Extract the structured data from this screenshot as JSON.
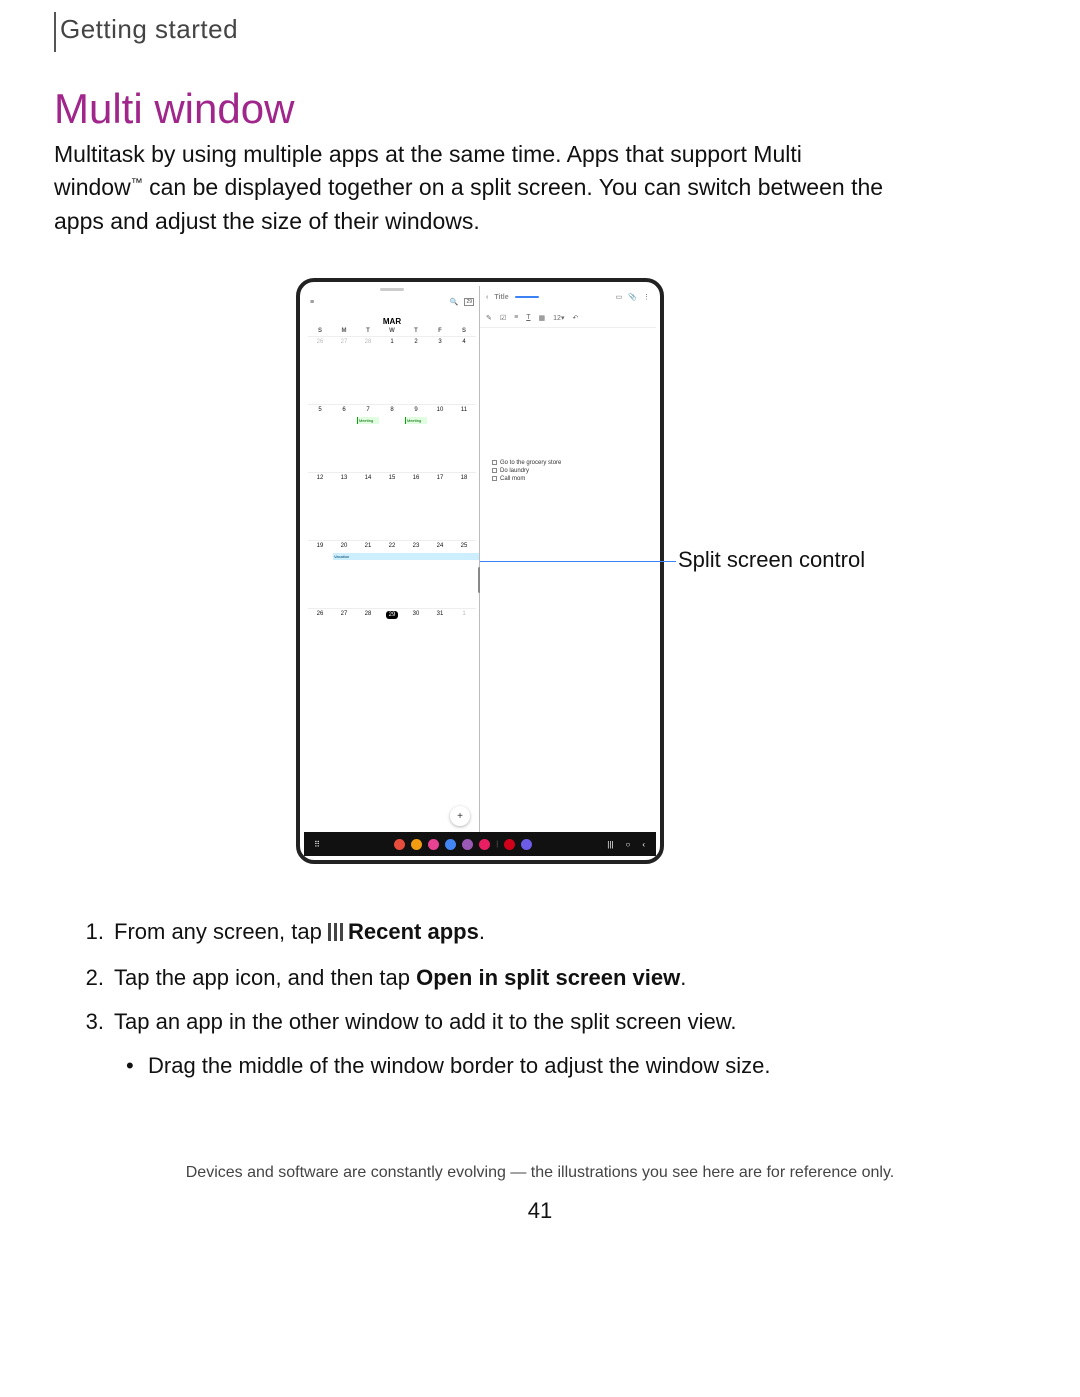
{
  "breadcrumb": "Getting started",
  "title": "Multi window",
  "intro_part1": "Multitask by using multiple apps at the same time. Apps that support Multi window",
  "intro_tm": "™",
  "intro_part2": " can be displayed together on a split screen. You can switch between the apps and adjust the size of their windows.",
  "callout": "Split screen control",
  "calendar": {
    "month": "MAR",
    "dow": [
      "S",
      "M",
      "T",
      "W",
      "T",
      "F",
      "S"
    ],
    "rows": [
      [
        "26",
        "27",
        "28",
        "1",
        "2",
        "3",
        "4"
      ],
      [
        "5",
        "6",
        "7",
        "8",
        "9",
        "10",
        "11"
      ],
      [
        "12",
        "13",
        "14",
        "15",
        "16",
        "17",
        "18"
      ],
      [
        "19",
        "20",
        "21",
        "22",
        "23",
        "24",
        "25"
      ],
      [
        "26",
        "27",
        "28",
        "29",
        "30",
        "31",
        "1"
      ]
    ],
    "faded_first": 3,
    "faded_last": 1,
    "today": "29",
    "event_meeting": "Meeting",
    "event_vacation": "Vacation",
    "fab": "+"
  },
  "notes": {
    "title_label": "Title",
    "font_size": "12",
    "items": [
      "Go to the grocery store",
      "Do laundry",
      "Call mom"
    ]
  },
  "steps": {
    "s1_prefix": "From any screen, tap ",
    "s1_bold": "Recent apps",
    "s1_suffix": ".",
    "s2_prefix": "Tap the app icon, and then tap ",
    "s2_bold": "Open in split screen view",
    "s2_suffix": ".",
    "s3": "Tap an app in the other window to add it to the split screen view.",
    "bullet": "Drag the middle of the window border to adjust the window size."
  },
  "footnote": "Devices and software are constantly evolving — the illustrations you see here are for reference only.",
  "page_number": "41",
  "taskbar_colors": [
    "#e74c3c",
    "#f39c12",
    "#e84393",
    "#4285f4",
    "#9b59b6",
    "#e91e63",
    "#d0021b",
    "#6c5ce7"
  ]
}
